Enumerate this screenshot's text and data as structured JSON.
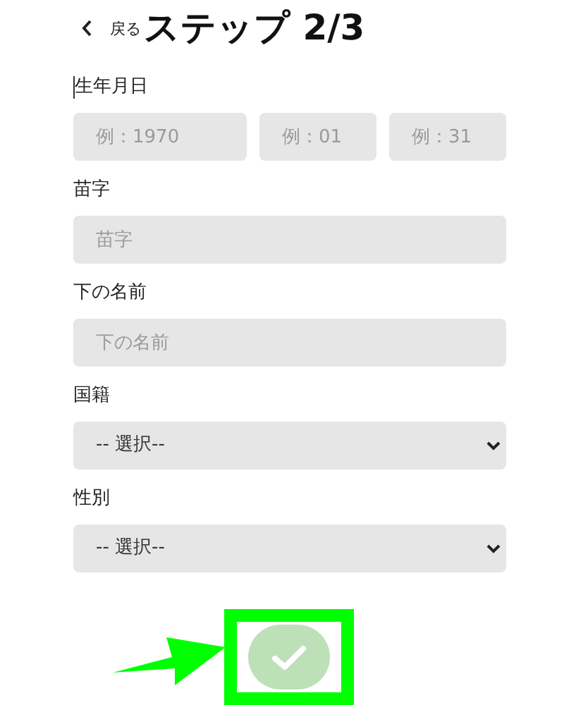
{
  "header": {
    "back_label": "戻る",
    "title": "ステップ 2/3"
  },
  "fields": [
    {
      "kind": "triple",
      "label": "生年月日",
      "focused": true,
      "inputs": [
        {
          "placeholder": "例：1970"
        },
        {
          "placeholder": "例：01"
        },
        {
          "placeholder": "例：31"
        }
      ]
    },
    {
      "kind": "text",
      "label": "苗字",
      "focused": false,
      "placeholder": "苗字"
    },
    {
      "kind": "text",
      "label": "下の名前",
      "focused": false,
      "placeholder": "下の名前"
    },
    {
      "kind": "select",
      "label": "国籍",
      "focused": false,
      "value": "-- 選択--"
    },
    {
      "kind": "select",
      "label": "性別",
      "focused": false,
      "value": "-- 選択--"
    }
  ],
  "submit": {
    "disabled": true
  },
  "annotation": {
    "highlighted": true
  }
}
